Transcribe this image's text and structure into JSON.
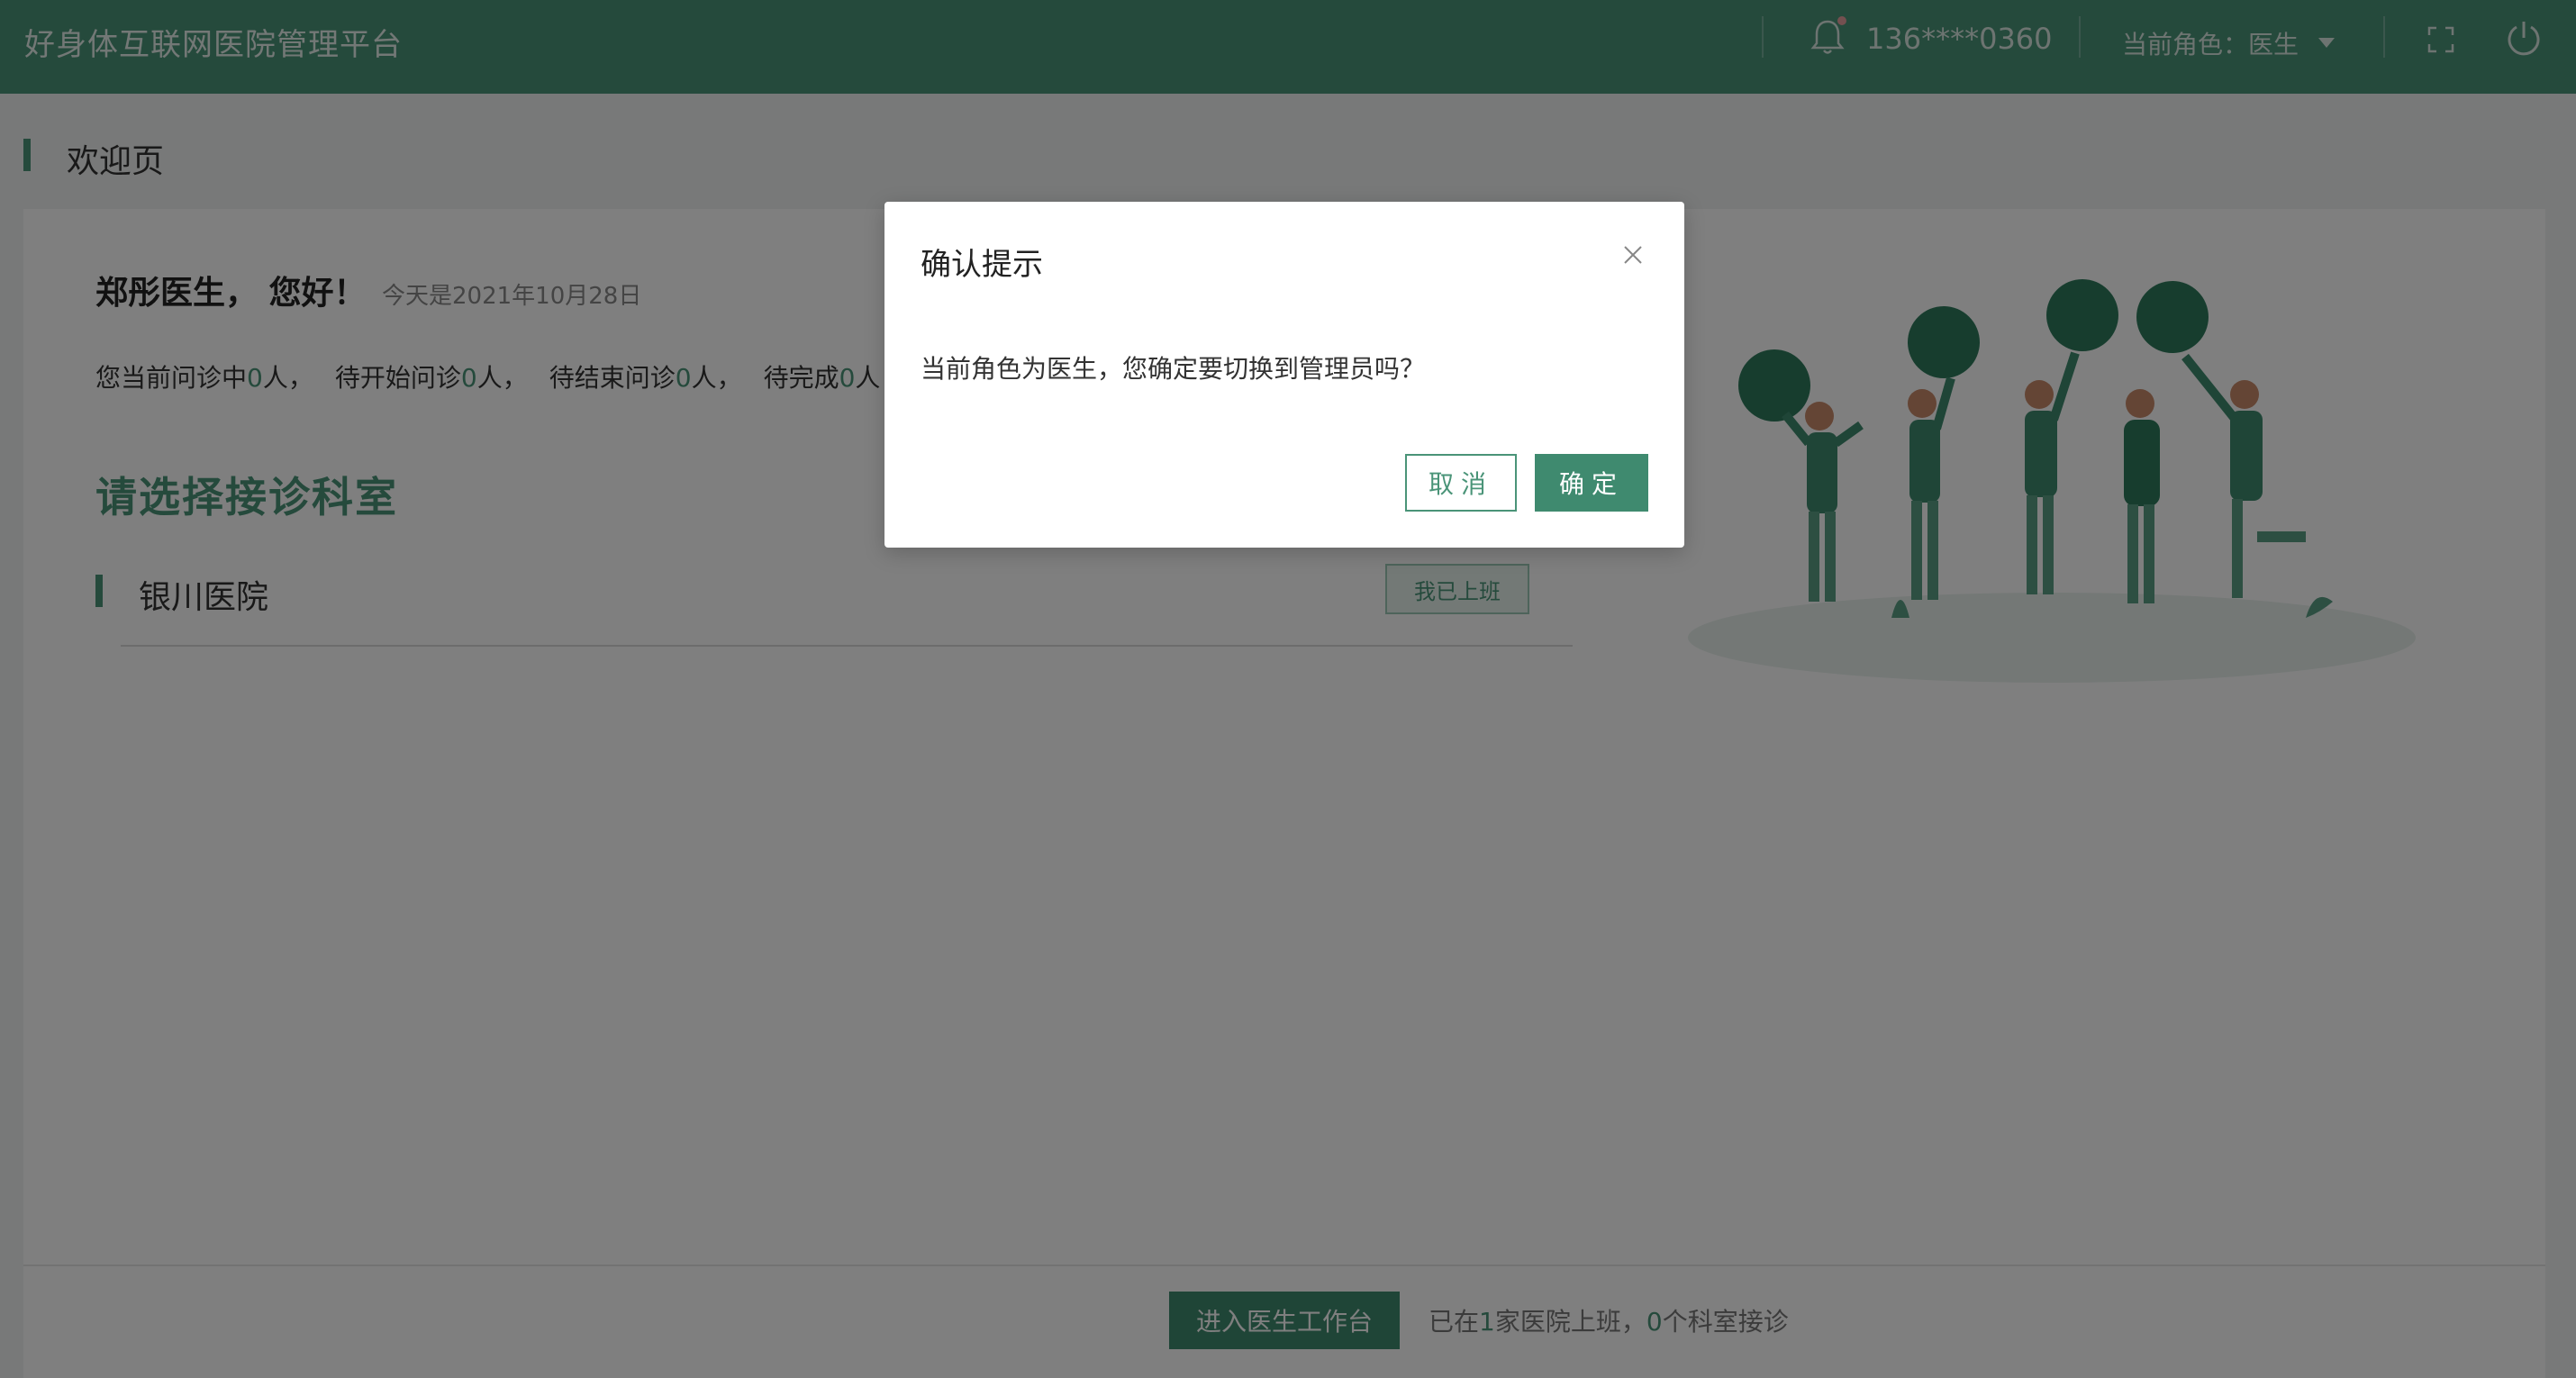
{
  "header": {
    "app_title": "好身体互联网医院管理平台",
    "phone": "136****0360",
    "role_label": "当前角色：医生"
  },
  "breadcrumb": {
    "label": "欢迎页"
  },
  "welcome": {
    "greeting": "郑彤医生， 您好！",
    "today": "今天是2021年10月28日",
    "stats": [
      {
        "prefix": "您当前问诊中",
        "value": "0",
        "suffix": "人，"
      },
      {
        "prefix": "待开始问诊",
        "value": "0",
        "suffix": "人，"
      },
      {
        "prefix": "待结束问诊",
        "value": "0",
        "suffix": "人，"
      },
      {
        "prefix": "待完成",
        "value": "0",
        "suffix": "人"
      }
    ],
    "section_title": "请选择接诊科室",
    "hospital_name": "银川医院",
    "on_duty_button": "我已上班"
  },
  "footer": {
    "enter_button": "进入医生工作台",
    "note_prefix": "已在",
    "hospitals_count": "1",
    "note_mid": "家医院上班，",
    "departments_count": "0",
    "note_suffix": "个科室接诊"
  },
  "dialog": {
    "title": "确认提示",
    "message": "当前角色为医生，您确定要切换到管理员吗？",
    "cancel_label": "取消",
    "confirm_label": "确定"
  },
  "colors": {
    "brand": "#4a9478",
    "header_bg": "#4a9478",
    "overlay": "rgba(0,0,0,0.5)"
  },
  "icons": {
    "bell": "bell-icon",
    "caret": "caret-down-icon",
    "fullscreen": "fullscreen-icon",
    "power": "power-icon",
    "close": "close-icon"
  }
}
